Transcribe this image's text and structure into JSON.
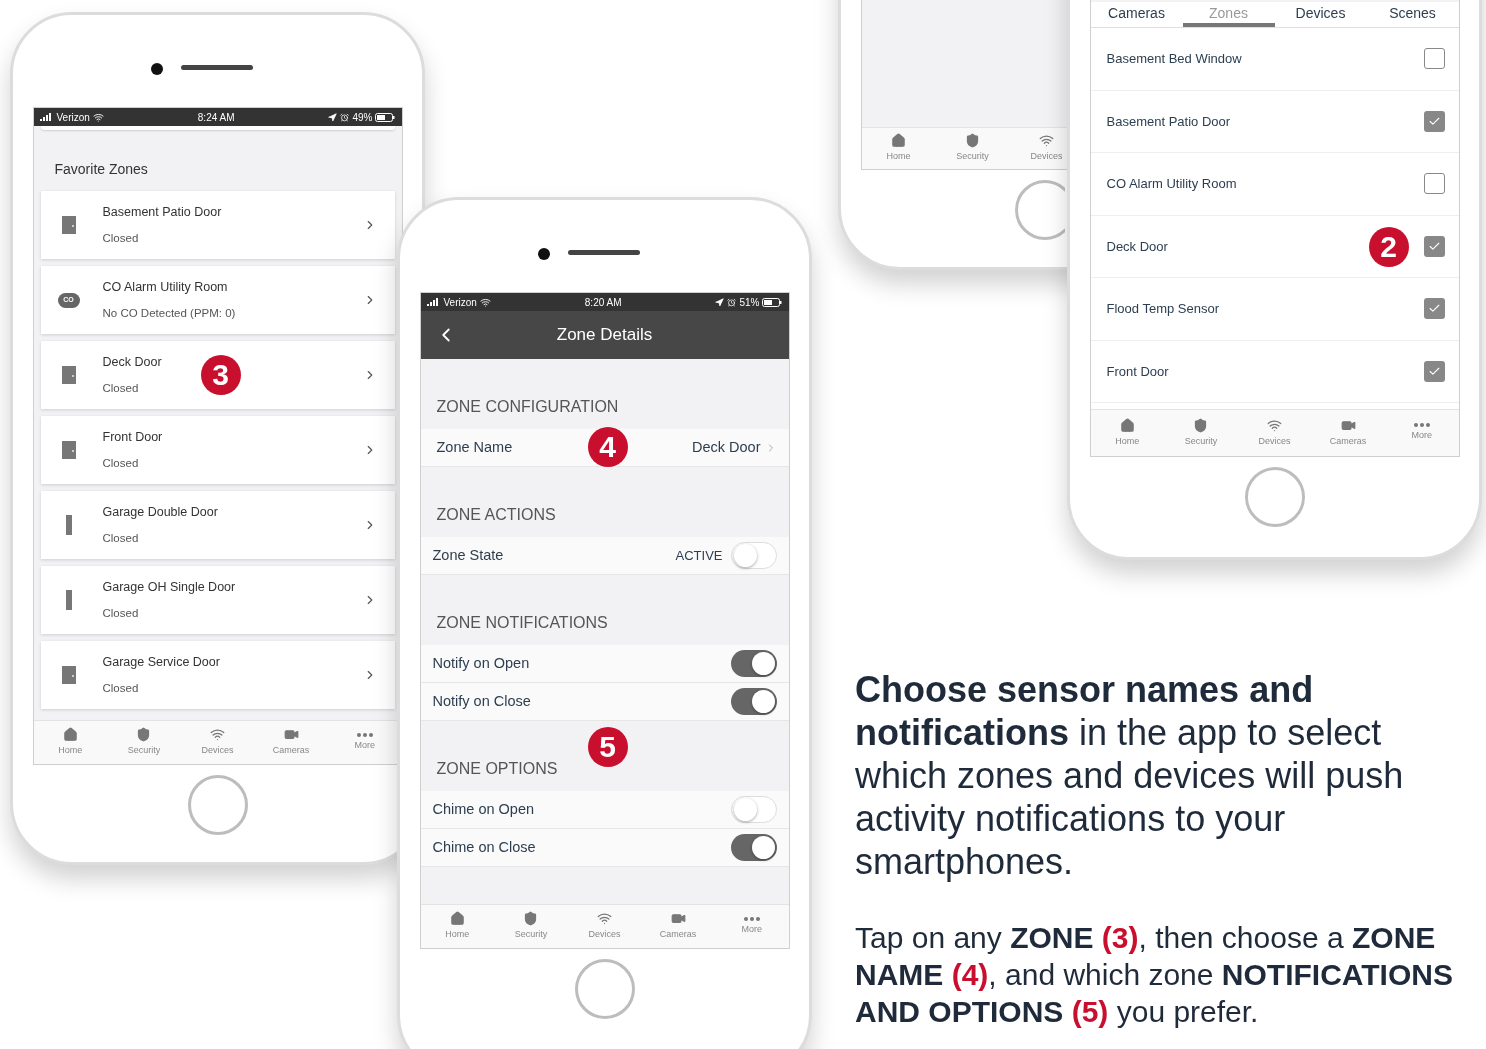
{
  "favorites_phone": {
    "status_bar": {
      "carrier": "Verizon",
      "time": "8:24 AM",
      "battery": "49%"
    },
    "section_title": "Favorite Zones",
    "zones": [
      {
        "kind": "door",
        "title": "Basement Patio Door",
        "subtitle": "Closed"
      },
      {
        "kind": "co",
        "icon_text": "CO",
        "title": "CO Alarm Utility Room",
        "subtitle": "No CO Detected (PPM: 0)"
      },
      {
        "kind": "door",
        "title": "Deck Door",
        "subtitle": "Closed",
        "badge": "3"
      },
      {
        "kind": "door",
        "title": "Front Door",
        "subtitle": "Closed"
      },
      {
        "kind": "garage",
        "title": "Garage Double Door",
        "subtitle": "Closed"
      },
      {
        "kind": "garage",
        "title": "Garage OH Single Door",
        "subtitle": "Closed"
      },
      {
        "kind": "door",
        "title": "Garage Service Door",
        "subtitle": "Closed"
      }
    ],
    "tab_bar": [
      {
        "kind": "home",
        "label": "Home"
      },
      {
        "kind": "security",
        "label": "Security"
      },
      {
        "kind": "devices",
        "label": "Devices"
      },
      {
        "kind": "cameras",
        "label": "Cameras"
      },
      {
        "kind": "more",
        "label": "More"
      }
    ]
  },
  "zone_details_phone": {
    "status_bar": {
      "carrier": "Verizon",
      "time": "8:20 AM",
      "battery": "51%"
    },
    "title": "Zone Details",
    "sections": [
      {
        "heading": "ZONE CONFIGURATION",
        "rows": [
          {
            "kind": "link",
            "label": "Zone Name",
            "value": "Deck Door",
            "badge": "4"
          }
        ]
      },
      {
        "heading": "ZONE ACTIONS",
        "rows": [
          {
            "kind": "toggle",
            "label": "Zone State",
            "value": "ACTIVE",
            "on": false
          }
        ]
      },
      {
        "heading": "ZONE NOTIFICATIONS",
        "badge": "5",
        "rows": [
          {
            "kind": "toggle",
            "label": "Notify on Open",
            "on": true
          },
          {
            "kind": "toggle",
            "label": "Notify on Close",
            "on": true
          }
        ]
      },
      {
        "heading": "ZONE OPTIONS",
        "rows": [
          {
            "kind": "toggle",
            "label": "Chime on Open",
            "on": false
          },
          {
            "kind": "toggle",
            "label": "Chime on Close",
            "on": true
          }
        ]
      }
    ],
    "tab_bar": [
      {
        "kind": "home",
        "label": "Home"
      },
      {
        "kind": "security",
        "label": "Security"
      },
      {
        "kind": "devices",
        "label": "Devices"
      },
      {
        "kind": "cameras",
        "label": "Cameras"
      },
      {
        "kind": "more",
        "label": "More"
      }
    ]
  },
  "background_phone": {
    "tab_bar": [
      {
        "kind": "home",
        "label": "Home"
      },
      {
        "kind": "security",
        "label": "Security"
      },
      {
        "kind": "devices",
        "label": "Devices"
      }
    ]
  },
  "zone_list_phone": {
    "tabs": [
      {
        "label": "Cameras",
        "selected": false
      },
      {
        "label": "Zones",
        "selected": true
      },
      {
        "label": "Devices",
        "selected": false
      },
      {
        "label": "Scenes",
        "selected": false
      }
    ],
    "zones": [
      {
        "label": "Basement Bed Window",
        "checked": false
      },
      {
        "label": "Basement Patio Door",
        "checked": true
      },
      {
        "label": "CO Alarm Utility Room",
        "checked": false
      },
      {
        "label": "Deck Door",
        "checked": true,
        "badge": "2"
      },
      {
        "label": "Flood Temp Sensor",
        "checked": true
      },
      {
        "label": "Front Door",
        "checked": true
      }
    ],
    "tab_bar": [
      {
        "kind": "home",
        "label": "Home"
      },
      {
        "kind": "security",
        "label": "Security"
      },
      {
        "kind": "devices",
        "label": "Devices"
      },
      {
        "kind": "cameras",
        "label": "Cameras"
      },
      {
        "kind": "more",
        "label": "More"
      }
    ]
  },
  "headline": "**Choose sensor names and notifications** in the app to select which zones and devices will push activity notifications to your smartphones.",
  "description": [
    {
      "kind": "plain",
      "text": "Tap on any "
    },
    {
      "kind": "bold",
      "text": "ZONE"
    },
    {
      "kind": "accent",
      "text": " (3)"
    },
    {
      "kind": "plain",
      "text": ", then choose a "
    },
    {
      "kind": "bold",
      "text": "ZONE NAME"
    },
    {
      "kind": "accent",
      "text": " (4)"
    },
    {
      "kind": "plain",
      "text": ", and which zone "
    },
    {
      "kind": "bold",
      "text": "NOTIFICATIONS AND OPTIONS"
    },
    {
      "kind": "accent",
      "text": " (5)"
    },
    {
      "kind": "plain",
      "text": " you prefer."
    }
  ]
}
